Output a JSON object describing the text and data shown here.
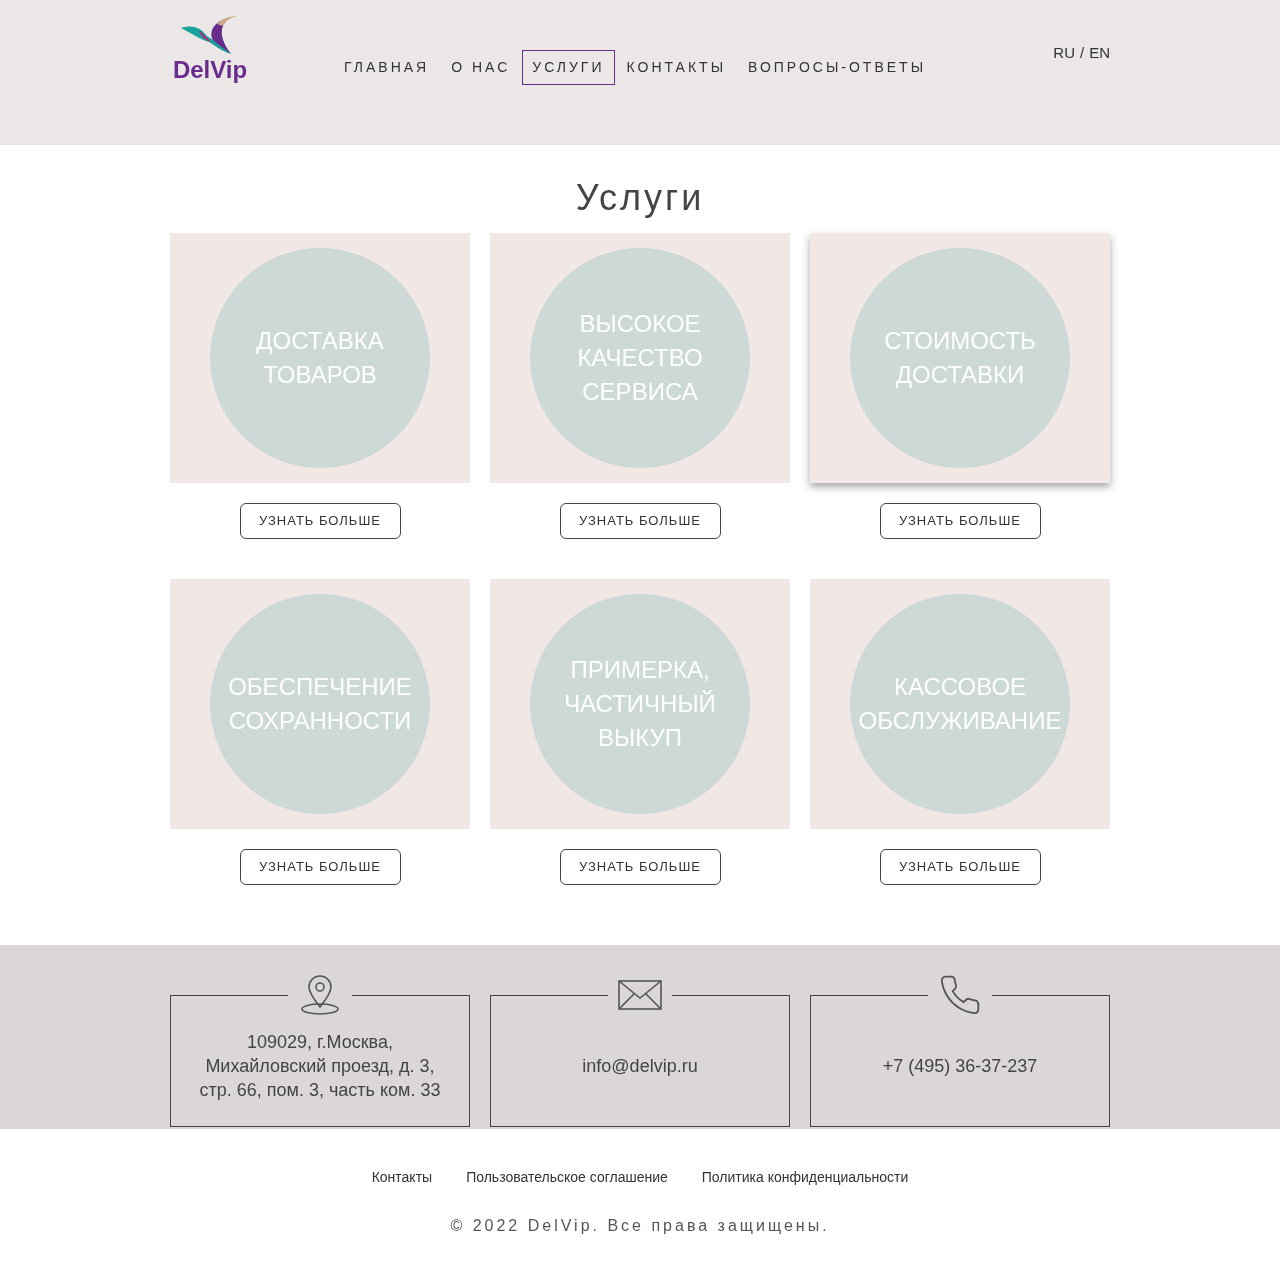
{
  "header": {
    "logo_text": "DelVip",
    "nav": [
      {
        "label": "ГЛАВНАЯ",
        "selected": false
      },
      {
        "label": "О НАС",
        "selected": false
      },
      {
        "label": "УСЛУГИ",
        "selected": true
      },
      {
        "label": "КОНТАКТЫ",
        "selected": false
      },
      {
        "label": "ВОПРОСЫ-ОТВЕТЫ",
        "selected": false
      }
    ],
    "languages": [
      "RU",
      "EN"
    ],
    "language_separator": "/"
  },
  "title": "Услуги",
  "services": [
    {
      "title": "ДОСТАВКА ТОВАРОВ",
      "button": "УЗНАТЬ БОЛЬШЕ",
      "raised": false
    },
    {
      "title": "ВЫСОКОЕ КАЧЕСТВО СЕРВИСА",
      "button": "УЗНАТЬ БОЛЬШЕ",
      "raised": false
    },
    {
      "title": "СТОИМОСТЬ ДОСТАВКИ",
      "button": "УЗНАТЬ БОЛЬШЕ",
      "raised": true
    },
    {
      "title": "ОБЕСПЕЧЕНИЕ СОХРАННОСТИ",
      "button": "УЗНАТЬ БОЛЬШЕ",
      "raised": false
    },
    {
      "title": "ПРИМЕРКА, ЧАСТИЧНЫЙ ВЫКУП",
      "button": "УЗНАТЬ БОЛЬШЕ",
      "raised": false
    },
    {
      "title": "КАССОВОЕ ОБСЛУЖИВАНИЕ",
      "button": "УЗНАТЬ БОЛЬШЕ",
      "raised": false
    }
  ],
  "contacts": [
    {
      "kind": "address",
      "text": "109029, г.Москва, Михайловский проезд, д. 3, стр. 66, пом. 3, часть ком. 33"
    },
    {
      "kind": "email",
      "text": "info@delvip.ru"
    },
    {
      "kind": "phone",
      "text": "+7 (495) 36-37-237"
    }
  ],
  "footer": {
    "links": [
      "Контакты",
      "Пользовательское соглашение",
      "Политика конфиденциальности"
    ],
    "copyright": "© 2022 DelVip. Все права защищены."
  }
}
